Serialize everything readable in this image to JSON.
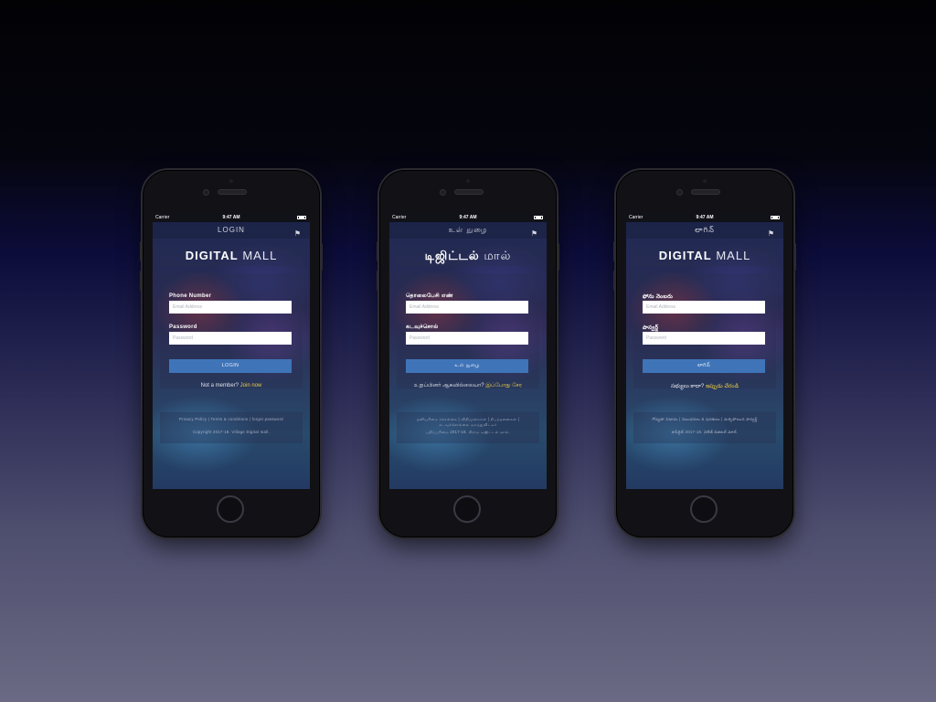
{
  "phones": [
    {
      "status": {
        "carrier": "Carrier",
        "time": "9:47 AM"
      },
      "nav_title": "LOGIN",
      "brand_bold": "DIGITAL",
      "brand_light": "MALL",
      "phone_label": "Phone Number",
      "phone_placeholder": "Email Address",
      "password_label": "Password",
      "password_placeholder": "Password",
      "button": "LOGIN",
      "member_text": "Not a member?",
      "join_text": "Join now",
      "footer_links": "Privacy Policy | Terms & conditions | forgot password",
      "copyright": "Copyright 2017-18. Village Digital mall."
    },
    {
      "status": {
        "carrier": "Carrier",
        "time": "9:47 AM"
      },
      "nav_title": "உள் நுழை",
      "brand_bold": "டிஜிட்டல்",
      "brand_light": "மால்",
      "phone_label": "தொலைபேசி எண்",
      "phone_placeholder": "Email Address",
      "password_label": "கடவுச்சொல்",
      "password_placeholder": "Password",
      "button": "உள் நுழை",
      "member_text": "உறுப்பினர் ஆகவில்லையா?",
      "join_text": "இப்போது சேர",
      "footer_links": "தனியுரிமை கொள்கை | விதிமுறைகள் | நிபந்தனைகள் | கடவுச்சொல்லை மறந்துவிட்டீர்",
      "copyright": "பதிப்புரிமை 2017-18. கிராம டிஜிட்டல் மால்."
    },
    {
      "status": {
        "carrier": "Carrier",
        "time": "9:47 AM"
      },
      "nav_title": "లాగిన్",
      "brand_bold": "DIGITAL",
      "brand_light": "MALL",
      "phone_label": "ఫోను నెంబరు",
      "phone_placeholder": "Email Address",
      "password_label": "పాస్వర్డ్",
      "password_placeholder": "Password",
      "button": "లాగిన్",
      "member_text": "సభ్యులు కాదా?",
      "join_text": "ఇప్పుడు చేరండి",
      "footer_links": "గోప్యతా విధానం | నిబంధనలు & షరతులు | మర్చిపోయిన పాస్వర్డ్",
      "copyright": "కాపీరైట్ 2017-18. విలేజ్ డిజిటల్ మాల్."
    }
  ]
}
